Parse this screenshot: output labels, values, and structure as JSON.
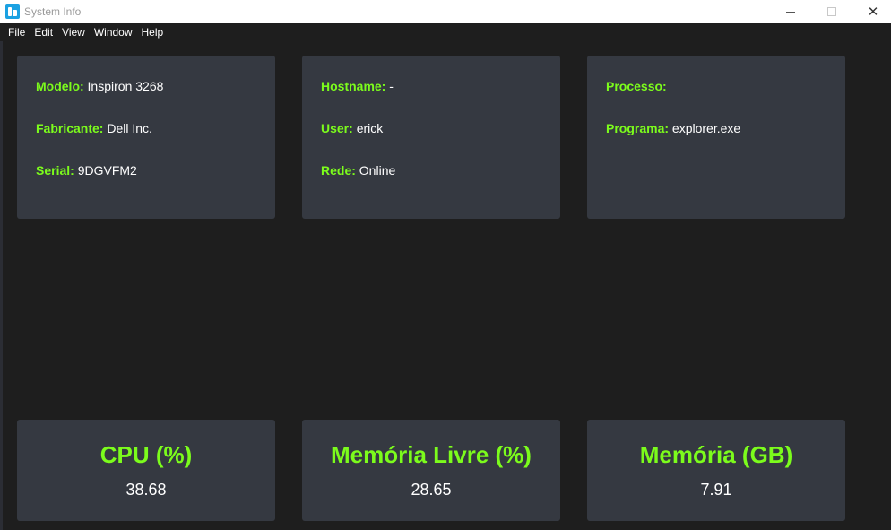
{
  "window": {
    "title": "System Info"
  },
  "menu": [
    "File",
    "Edit",
    "View",
    "Window",
    "Help"
  ],
  "info_cards": [
    {
      "rows": [
        {
          "label": "Modelo:",
          "value": "Inspiron 3268"
        },
        {
          "label": "Fabricante:",
          "value": "Dell Inc."
        },
        {
          "label": "Serial:",
          "value": "9DGVFM2"
        }
      ]
    },
    {
      "rows": [
        {
          "label": "Hostname:",
          "value": "-"
        },
        {
          "label": "User:",
          "value": "erick"
        },
        {
          "label": "Rede:",
          "value": "Online"
        }
      ]
    },
    {
      "rows": [
        {
          "label": "Processo:",
          "value": ""
        },
        {
          "label": "Programa:",
          "value": "explorer.exe"
        }
      ]
    }
  ],
  "metrics": [
    {
      "title": "CPU (%)",
      "value": "38.68"
    },
    {
      "title": "Memória Livre (%)",
      "value": "28.65"
    },
    {
      "title": "Memória (GB)",
      "value": "7.91"
    }
  ],
  "colors": {
    "accent": "#7cfc1c",
    "card": "#353941",
    "background": "#1e1e1e"
  },
  "icons": {
    "app": "app-icon",
    "minimize": "minimize-icon",
    "maximize": "maximize-icon",
    "close": "close-icon"
  }
}
